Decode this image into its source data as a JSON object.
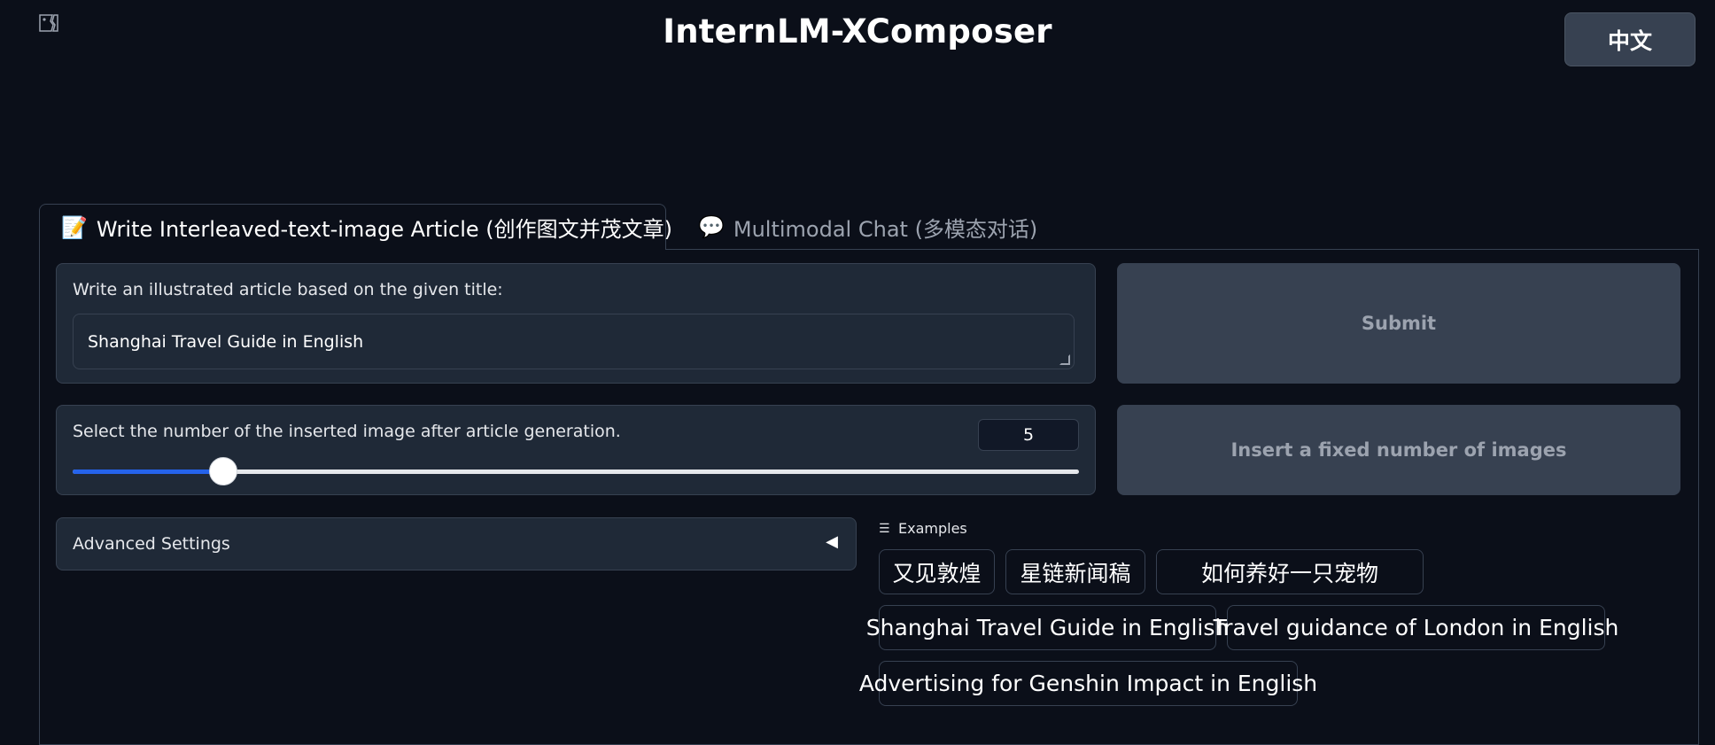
{
  "header": {
    "title": "InternLM-XComposer",
    "lang_button": "中文",
    "logo_icon": "broken-image-icon"
  },
  "tabs": [
    {
      "icon": "📝",
      "label": "Write Interleaved-text-image Article (创作图文并茂文章)",
      "active": true
    },
    {
      "icon": "💬",
      "label": "Multimodal Chat (多模态对话)",
      "active": false
    }
  ],
  "article": {
    "title_label": "Write an illustrated article based on the given title:",
    "title_value": "Shanghai Travel Guide in English",
    "image_count_label": "Select the number of the inserted image after article generation.",
    "image_count_value": "5",
    "image_count_fraction": 0.15,
    "submit_label": "Submit",
    "insert_label": "Insert a fixed number of images",
    "advanced_label": "Advanced Settings",
    "advanced_arrow": "◀"
  },
  "examples": {
    "label": "Examples",
    "icon": "list-icon",
    "items": [
      "又见敦煌",
      "星链新闻稿",
      "如何养好一只宠物",
      "Shanghai Travel Guide in English",
      "Travel guidance of London in English",
      "Advertising for Genshin Impact in English"
    ]
  },
  "colors": {
    "background": "#0b0f19",
    "block": "#1f2937",
    "border": "#374151",
    "accent": "#2563eb"
  }
}
